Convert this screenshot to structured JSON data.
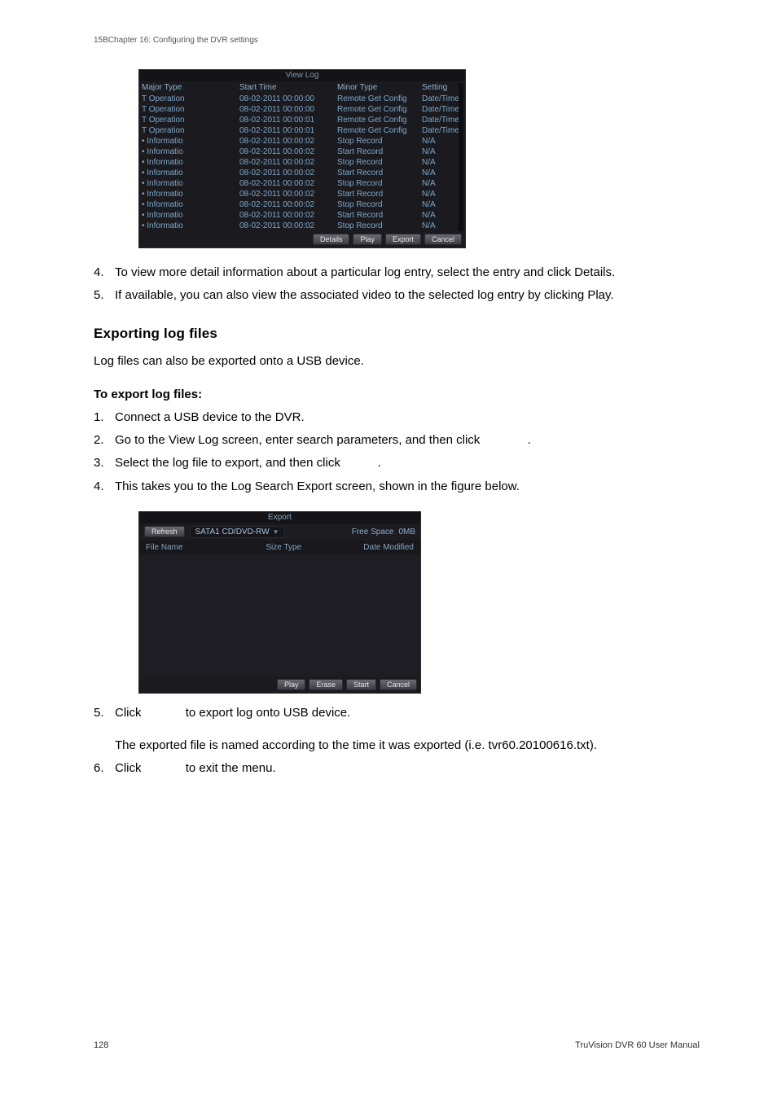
{
  "chapter_header": "15BChapter 16: Configuring the DVR settings",
  "viewlog": {
    "title": "View Log",
    "headers": {
      "major": "Major Type",
      "start": "Start Time",
      "minor": "Minor Type",
      "setting": "Setting"
    },
    "rows": [
      {
        "major": "T Operation",
        "start": "08-02-2011 00:00:00",
        "minor": "Remote Get Config",
        "setting": "Date/Time"
      },
      {
        "major": "T Operation",
        "start": "08-02-2011 00:00:00",
        "minor": "Remote Get Config",
        "setting": "Date/Time"
      },
      {
        "major": "T Operation",
        "start": "08-02-2011 00:00:01",
        "minor": "Remote Get Config",
        "setting": "Date/Time"
      },
      {
        "major": "T Operation",
        "start": "08-02-2011 00:00:01",
        "minor": "Remote Get Config",
        "setting": "Date/Time"
      },
      {
        "major": "• Informatio",
        "start": "08-02-2011 00:00:02",
        "minor": "Stop Record",
        "setting": "N/A"
      },
      {
        "major": "• Informatio",
        "start": "08-02-2011 00:00:02",
        "minor": "Start Record",
        "setting": "N/A"
      },
      {
        "major": "• Informatio",
        "start": "08-02-2011 00:00:02",
        "minor": "Stop Record",
        "setting": "N/A"
      },
      {
        "major": "• Informatio",
        "start": "08-02-2011 00:00:02",
        "minor": "Start Record",
        "setting": "N/A"
      },
      {
        "major": "• Informatio",
        "start": "08-02-2011 00:00:02",
        "minor": "Stop Record",
        "setting": "N/A"
      },
      {
        "major": "• Informatio",
        "start": "08-02-2011 00:00:02",
        "minor": "Start Record",
        "setting": "N/A"
      },
      {
        "major": "• Informatio",
        "start": "08-02-2011 00:00:02",
        "minor": "Stop Record",
        "setting": "N/A"
      },
      {
        "major": "• Informatio",
        "start": "08-02-2011 00:00:02",
        "minor": "Start Record",
        "setting": "N/A"
      },
      {
        "major": "• Informatio",
        "start": "08-02-2011 00:00:02",
        "minor": "Stop Record",
        "setting": "N/A"
      }
    ],
    "buttons": {
      "details": "Details",
      "play": "Play",
      "export": "Export",
      "cancel": "Cancel"
    }
  },
  "steps_a": {
    "s4": "To view more detail information about a particular log entry, select the entry and click Details.",
    "s5": "If available, you can also view the associated video to the selected log entry by clicking Play."
  },
  "section_heading": "Exporting log files",
  "section_para": "Log files can also be exported onto a USB device.",
  "subheading": "To export log files:",
  "steps_b": {
    "s1": "Connect a USB device to the DVR.",
    "s2": "Go to the View Log screen, enter search parameters, and then click",
    "s2_tail": ".",
    "s3": "Select the log file to export, and then click",
    "s3_tail": ".",
    "s4": "This takes you to the Log Search Export screen, shown in the figure below."
  },
  "exportdlg": {
    "title": "Export",
    "refresh": "Refresh",
    "device": "SATA1 CD/DVD-RW",
    "free_label": "Free Space",
    "free_value": "0MB",
    "cols": {
      "name": "File Name",
      "size": "Size Type",
      "date": "Date Modified"
    },
    "buttons": {
      "play": "Play",
      "erase": "Erase",
      "start": "Start",
      "cancel": "Cancel"
    }
  },
  "steps_c": {
    "s5_pre": "Click",
    "s5_post": "to export log onto USB device.",
    "s5_cont": "The exported file is named according to the time it was exported (i.e. tvr60.20100616.txt).",
    "s6_pre": "Click",
    "s6_post": "to exit the menu."
  },
  "footer": {
    "page": "128",
    "manual": "TruVision DVR 60 User Manual"
  }
}
